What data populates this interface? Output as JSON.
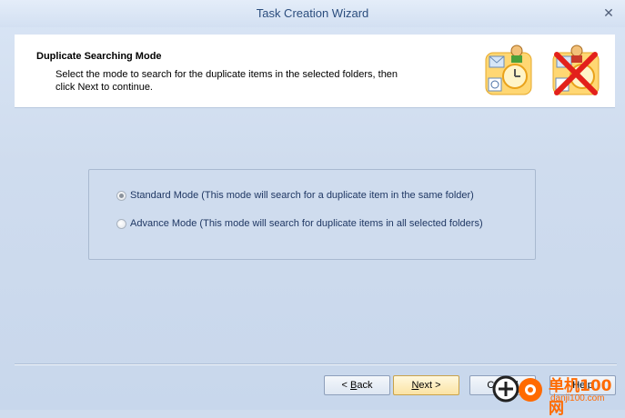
{
  "window": {
    "title": "Task Creation Wizard",
    "close_icon": "close-icon"
  },
  "header": {
    "title": "Duplicate Searching Mode",
    "description": "Select the mode to search for the duplicate items in the selected folders, then click Next to continue.",
    "icons": [
      "outlook-items-icon",
      "outlook-items-remove-icon"
    ]
  },
  "modes": {
    "standard_label": "Standard Mode (This mode will search for a duplicate item in the same folder)",
    "standard_selected": true,
    "advance_label": "Advance Mode (This mode will search for duplicate items in all selected folders)",
    "advance_selected": false
  },
  "buttons": {
    "back_label": "Back",
    "back_mnemonic": "B",
    "back_rest": "ack",
    "next_label": "Next >",
    "next_mnemonic": "N",
    "next_rest": "ext >",
    "cancel_label": "Cancel",
    "help_label": "Help"
  },
  "watermark": {
    "line1": "单机100网",
    "line2": "danji100.com"
  },
  "colors": {
    "title_text": "#2b4d7d",
    "background": "#cfdcee",
    "accent_orange": "#ff6a00"
  }
}
